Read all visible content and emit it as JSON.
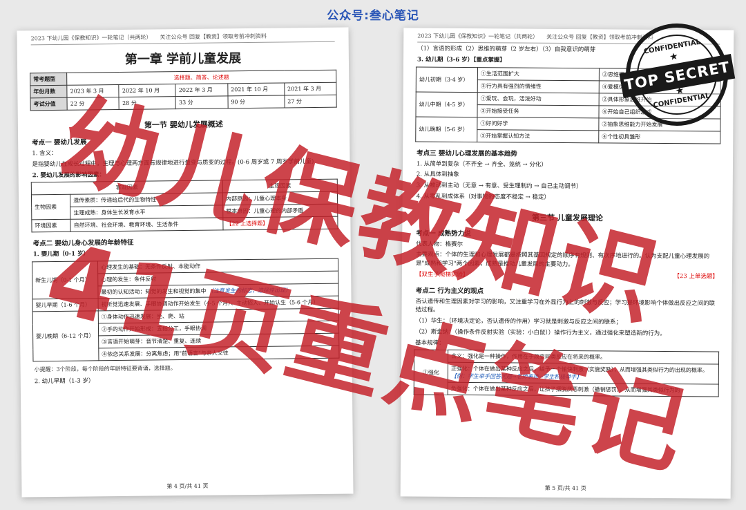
{
  "top_brand": "公众号:叁心笔记",
  "page1": {
    "header": "2023 下幼儿园《保教知识》一轮笔记（共两轮）　　关注公众号 回复【教资】领取考前冲刺资料",
    "chapter_title": "第一章 学前儿童发展",
    "exam_table": {
      "type_label": "常考题型",
      "type_value": "选择题、简答、论述题",
      "year_label": "年份月数",
      "years": [
        "2023 年 3 月",
        "2022 年 10 月",
        "2022 年 3 月",
        "2021 年 10 月",
        "2021 年 3 月"
      ],
      "score_label": "考试分值",
      "scores": [
        "22 分",
        "28 分",
        "33 分",
        "90 分",
        "27 分"
      ]
    },
    "section1": "第一节 婴幼儿发展概述",
    "kp1": "考点一 婴幼儿发展",
    "def_label": "1. 含义：",
    "def_text": "是指婴幼儿在成长过程中，生理与心理两方面有规律地进行量变与质变的过程。(0-6 周岁或 7 周岁学前儿童)",
    "factors_label": "2. 婴幼儿发展的影响因素：",
    "factors_table": {
      "h_obj": "客观因素",
      "h_sub": "主观因素",
      "rows": [
        [
          "生物因素",
          "遗传素质：传递给后代的生物特性",
          "内部原因：儿童心理本身"
        ],
        [
          "",
          "生理成熟：身体生长发育水平",
          "根本原因：儿童心理的内部矛盾"
        ],
        [
          "环境因素",
          "自然环境、社会环境、教育环境、生活条件",
          ""
        ]
      ],
      "tag": "【22 上选择题】"
    },
    "kp2": "考点二 婴幼儿身心发展的年龄特征",
    "infant_label": "1. 婴儿期（0-1 岁）",
    "age_rows": [
      {
        "period": "新生儿期（0-1 个月）",
        "items": [
          "心理发生的基础：无条件反射、本能动作",
          "心理的发生：条件反射",
          "最初的认知活动：知觉的发生和视觉的集中"
        ],
        "tag": "（注意发生的标志，选择性出现）"
      },
      {
        "period": "婴儿早期（1-6 个月）",
        "items": [
          "视听觉迅速发展、手眼协调动作开始发生（4-5 个月）、主动招人、开始认生（5-6 个月）"
        ],
        "tag": ""
      },
      {
        "period": "婴儿晚期（6-12 个月）",
        "items": [
          "①身体动作迅速发展：坐、爬、站",
          "②手的动作开始形成：五指分工，手眼协调",
          "③言语开始萌芽：音节清楚、重复、连续",
          "④依恋关系发展：分离焦虑；用\"前语言\"与亲人交往"
        ],
        "tag": ""
      }
    ],
    "note": "小提醒：3个阶段，每个阶段的年龄特征要背诵，选择题。",
    "next_label": "2. 幼儿早期（1-3 岁）",
    "footer": "第 4 页/共 41 页"
  },
  "page2": {
    "header": "2023 下幼儿园《保教知识》一轮笔记（共两轮）　　关注公众号 回复【教资】领取考前冲刺资料",
    "top_line": "（1）言语的形成（2）思维的萌芽（2 岁左右）（3）自我意识的萌芽",
    "preschool_label": "3. 幼儿期（3-6 岁）【重点掌握】",
    "stages": [
      {
        "name": "幼儿初期（3-4 岁）",
        "cells": [
          "①生活范围扩大",
          "②思维带有直觉行动性",
          "③行为具有强烈的情绪性",
          "④爱模仿"
        ]
      },
      {
        "name": "幼儿中期（4-5 岁）",
        "cells": [
          "①爱玩、会玩，活泼好动",
          "②具体形象思维开始",
          "③开始接受任务",
          "④开始自己组织游戏"
        ]
      },
      {
        "name": "幼儿晚期（5-6 岁）",
        "cells": [
          "①好问好学",
          "②抽象思维能力开始发展",
          "③开始掌握认知方法",
          "④个性初具雏形"
        ]
      }
    ],
    "kp3": "考点三 婴幼儿心理发展的基本趋势",
    "trend1": "1. 从简单到复杂（不齐全 → 齐全、笼统 → 分化）",
    "trend2": "2. 从具体到抽象",
    "trend3": "3. 从被动到主动（无意 → 有意、受生理制约 → 自己主动调节）",
    "trend4": "4. 从零乱到成体系（对事物的态度不稳定 → 稳定）",
    "section3": "第三节 儿童发展理论",
    "kp_a": "考点一 成熟势力说",
    "rep_label": "代表人物：格赛尔",
    "rep_text": "主要观点：个体的生理和心理发展都是按照其基因规定的顺序有规则、有次序地进行的。认为支配儿童心理发展的是\"成熟和学习\"两个因素，成熟是推动儿童发展的主要动力。",
    "tag2": "【双生子爬梯实验】",
    "tag3": "【23 上单选题】",
    "kp_b": "考点二 行为主义的观点",
    "beh_text": "否认遗传和生理因素对学习的影响，又注重学习在外显行为上的刺激与反应；学习是环境影响个体做出反应之间的联结过程。",
    "w1": "（1）华生：（环境决定论，否认遗传的作用）学习就是刺激与反应之间的联系；",
    "w2": "（2）斯金纳：（操作条件反射实验（实验：小白鼠））操作行为主义，通过强化来塑造新的行为。",
    "basic_label": "基本规律：",
    "reinforce": {
      "label": "①强化",
      "rows": [
        "含义：强化是一种操作，作用在于改变同类反应在将来的概率。",
        "正强化：个体在做出某种反应之后，给予一个愉快刺激（实施奖励），从而增强其类似行为的出现的概率。",
        "负强化：个体在做出某种反应之后，让孩子摆脱厌恶刺激（撤销惩罚），从而增强其类似行为的"
      ],
      "example": "【例：学生举手回答问题→老师表扬→学生积极举手】"
    },
    "footer": "第 5 页/共 41 页"
  },
  "overlay_line1": "幼儿保教知识",
  "overlay_line2": "41页重点笔记",
  "stamp": {
    "top": "CONFIDENTIAL",
    "band": "TOP SECRET",
    "bottom": "CONFIDENTIAL",
    "star": "★"
  }
}
